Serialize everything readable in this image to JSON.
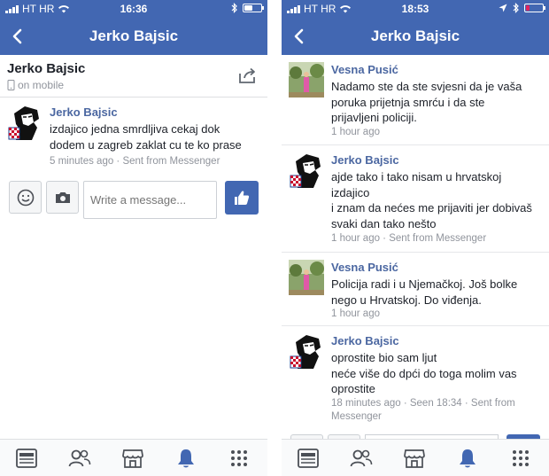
{
  "left": {
    "status": {
      "carrier": "HT HR",
      "time": "16:36"
    },
    "nav": {
      "title": "Jerko Bajsic",
      "back_icon": "chevron-left-icon"
    },
    "contact": {
      "name": "Jerko Bajsic",
      "status": "on mobile"
    },
    "messages": [
      {
        "author": "Jerko Bajsic",
        "lines": [
          "izdajico jedna smrdljiva cekaj dok",
          "dodem u zagreb zaklat cu te ko prase"
        ],
        "meta": "5 minutes ago · Sent from Messenger"
      }
    ],
    "composer": {
      "placeholder": "Write a message..."
    }
  },
  "right": {
    "status": {
      "carrier": "HT HR",
      "time": "18:53"
    },
    "nav": {
      "title": "Jerko Bajsic",
      "back_icon": "chevron-left-icon"
    },
    "messages": [
      {
        "author": "Vesna Pusić",
        "lines": [
          "Nadamo ste da ste svjesni da je vaša",
          "poruka prijetnja smrću i da ste",
          "prijavljeni policiji."
        ],
        "meta": "1 hour ago"
      },
      {
        "author": "Jerko Bajsic",
        "lines": [
          "ajde tako i tako nisam u hrvatskoj",
          "izdajico",
          "i znam da nećes me prijaviti jer dobivaš",
          "svaki dan tako nešto"
        ],
        "meta": "1 hour ago · Sent from Messenger"
      },
      {
        "author": "Vesna Pusić",
        "lines": [
          "Policija radi i u Njemačkoj. Još bolke",
          "nego u Hrvatskoj. Do viđenja."
        ],
        "meta": "1 hour ago"
      },
      {
        "author": "Jerko Bajsic",
        "lines": [
          "oprostite bio sam ljut",
          "neće više do dpći do toga molim vas",
          "oprostite"
        ],
        "meta": "18 minutes ago · Seen 18:34 · Sent from Messenger"
      }
    ]
  },
  "colors": {
    "brand": "#4267b2",
    "name_link": "#4b67a1",
    "meta": "#90949c",
    "active_tab": "#4267b2"
  },
  "tabs": [
    "news-feed-icon",
    "friends-icon",
    "marketplace-icon",
    "notifications-bell-icon",
    "more-menu-icon"
  ],
  "active_tab": "notifications-bell-icon"
}
